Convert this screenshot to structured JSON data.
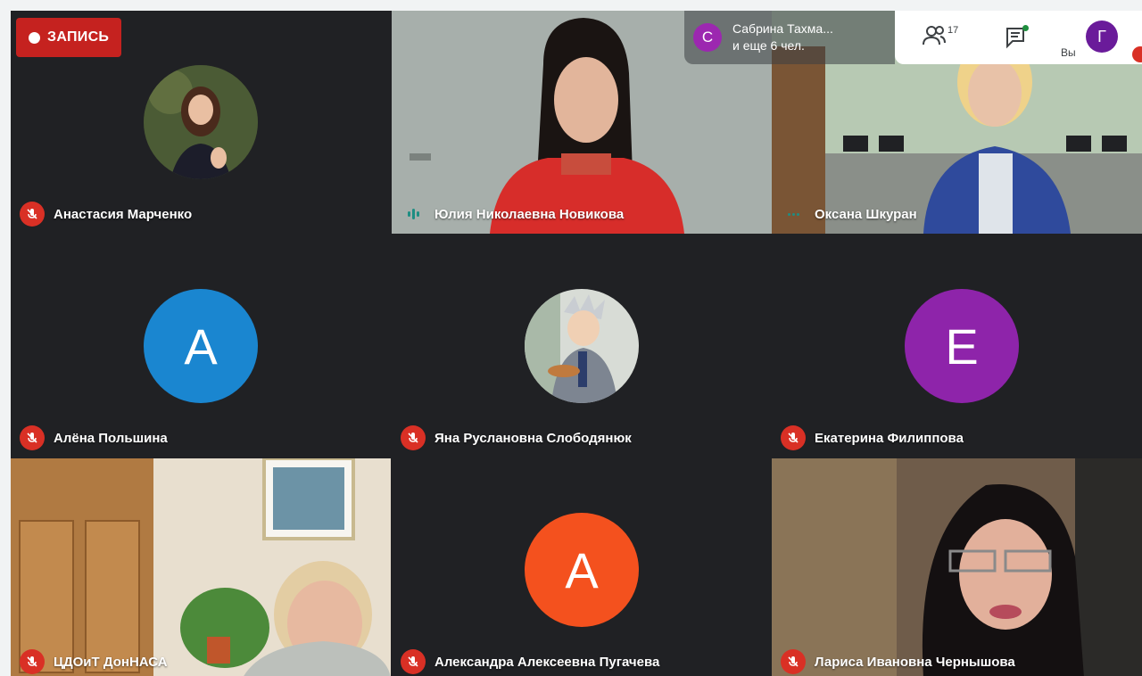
{
  "record": {
    "label": "ЗАПИСЬ"
  },
  "presenting": {
    "avatar_letter": "С",
    "line1": "Сабрина Тахма...",
    "line2": "и еще 6 чел."
  },
  "toolbar": {
    "people_count": "17",
    "you_label": "Вы",
    "self_avatar_letter": "Г"
  },
  "participants": [
    {
      "name": "Анастасия Марченко",
      "muted": true
    },
    {
      "name": "Юлия Николаевна Новикова",
      "muted": false,
      "speaking": true
    },
    {
      "name": "Оксана Шкуран",
      "muted": false
    },
    {
      "name": "Алёна Польшина",
      "muted": true,
      "avatar_letter": "А",
      "avatar_color": "#1a86d0"
    },
    {
      "name": "Яна Руслановна Слободянюк",
      "muted": true
    },
    {
      "name": "Екатерина Филиппова",
      "muted": true,
      "avatar_letter": "Е",
      "avatar_color": "#8e24aa"
    },
    {
      "name": "ЦДОиТ ДонНАСА",
      "muted": true
    },
    {
      "name": "Александра Алексеевна Пугачева",
      "muted": true,
      "avatar_letter": "А",
      "avatar_color": "#f4511e"
    },
    {
      "name": "Лариса Ивановна Чернышова",
      "muted": true
    }
  ],
  "colors": {
    "stage": "#202124",
    "record": "#c5221f",
    "mic_off": "#d93025",
    "speaking": "#1e8e83"
  }
}
